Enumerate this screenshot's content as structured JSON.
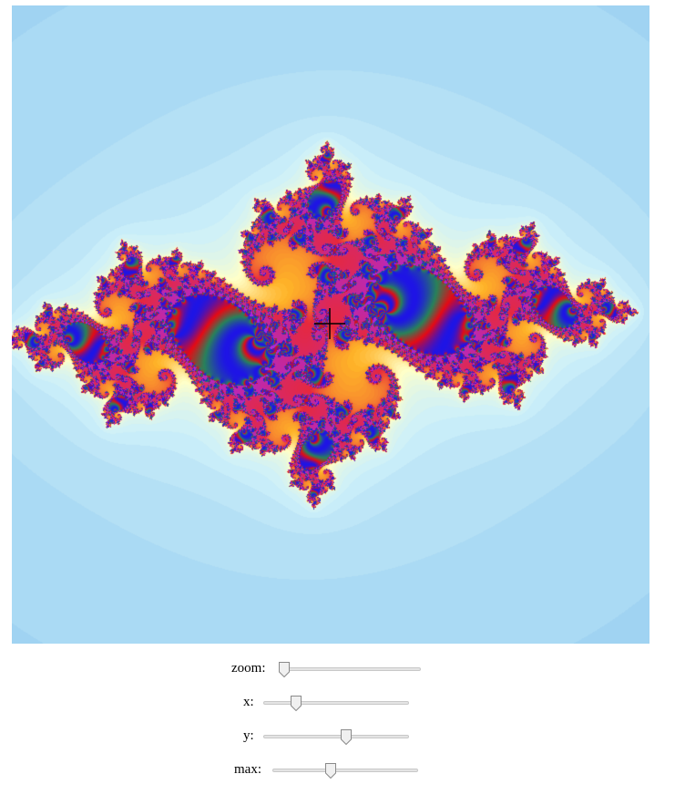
{
  "controls": [
    {
      "key": "zoom",
      "label": "zoom:",
      "value": 0.02
    },
    {
      "key": "x",
      "label": "x:",
      "value": 0.22
    },
    {
      "key": "y",
      "label": "y:",
      "value": 0.57
    },
    {
      "key": "max",
      "label": "max:",
      "value": 0.4
    }
  ],
  "colors": {
    "slider_track": "#e4e4e4",
    "thumb_fill": "#f0f0f0",
    "thumb_border": "#8a8a8a",
    "crosshair": "#000000"
  }
}
